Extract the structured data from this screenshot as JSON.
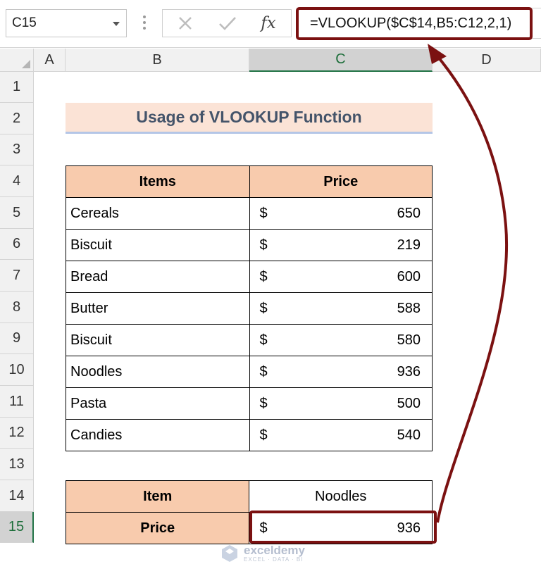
{
  "formula_bar": {
    "name_box": "C15",
    "formula": "=VLOOKUP($C$14,B5:C12,2,1)"
  },
  "columns": [
    "A",
    "B",
    "C",
    "D"
  ],
  "selected_column": "C",
  "rows": [
    "1",
    "2",
    "3",
    "4",
    "5",
    "6",
    "7",
    "8",
    "9",
    "10",
    "11",
    "12",
    "13",
    "14",
    "15"
  ],
  "selected_row": "15",
  "title": "Usage of VLOOKUP Function",
  "table": {
    "headers": [
      "Items",
      "Price"
    ],
    "rows": [
      {
        "item": "Cereals",
        "currency": "$",
        "price": "650"
      },
      {
        "item": "Biscuit",
        "currency": "$",
        "price": "219"
      },
      {
        "item": "Bread",
        "currency": "$",
        "price": "600"
      },
      {
        "item": "Butter",
        "currency": "$",
        "price": "588"
      },
      {
        "item": "Biscuit",
        "currency": "$",
        "price": "580"
      },
      {
        "item": "Noodles",
        "currency": "$",
        "price": "936"
      },
      {
        "item": "Pasta",
        "currency": "$",
        "price": "500"
      },
      {
        "item": "Candies",
        "currency": "$",
        "price": "540"
      }
    ]
  },
  "lookup": {
    "item_label": "Item",
    "item_value": "Noodles",
    "price_label": "Price",
    "price_currency": "$",
    "price_value": "936"
  },
  "watermark": {
    "name": "exceldemy",
    "tagline": "EXCEL · DATA · BI"
  },
  "colors": {
    "highlight": "#7b1111",
    "header_fill": "#f8cbad",
    "title_fill": "#fbe3d6",
    "title_text": "#44546a"
  }
}
